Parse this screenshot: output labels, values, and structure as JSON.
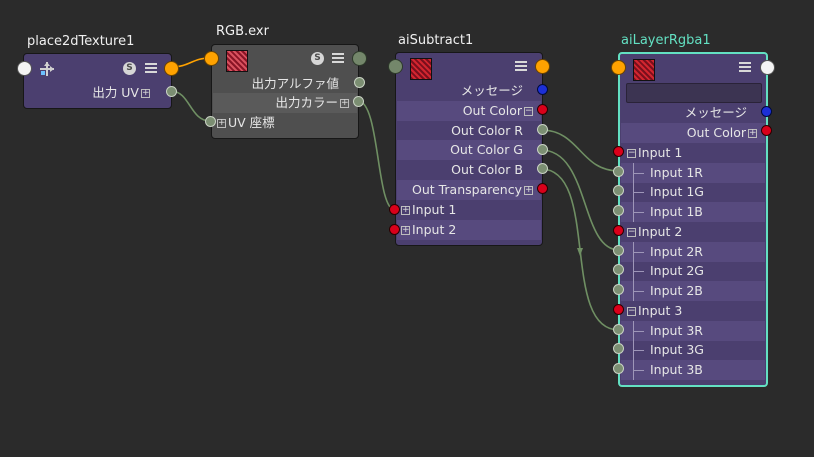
{
  "nodes": {
    "place2d": {
      "title": "place2dTexture1",
      "out_uv": "出力 UV",
      "icon": "transform-icon"
    },
    "rgb": {
      "title": "RGB.exr",
      "out_alpha": "出力アルファ値",
      "out_color": "出力カラー",
      "uv_coord": "UV 座標",
      "icon": "texture-swatch-icon"
    },
    "subtract": {
      "title": "aiSubtract1",
      "message": "メッセージ",
      "out_color": "Out Color",
      "out_r": "Out Color R",
      "out_g": "Out Color G",
      "out_b": "Out Color B",
      "out_transparency": "Out Transparency",
      "input1": "Input 1",
      "input2": "Input 2"
    },
    "layer": {
      "title": "aiLayerRgba1",
      "message": "メッセージ",
      "out_color": "Out Color",
      "input1": "Input 1",
      "input1r": "Input 1R",
      "input1g": "Input 1G",
      "input1b": "Input 1B",
      "input2": "Input 2",
      "input2r": "Input 2R",
      "input2g": "Input 2G",
      "input2b": "Input 2B",
      "input3": "Input 3",
      "input3r": "Input 3R",
      "input3g": "Input 3G",
      "input3b": "Input 3B"
    }
  },
  "icons": {
    "swatch_badge": "S"
  },
  "colors": {
    "background": "#2b2b2b",
    "node_purple": "#4b3f6f",
    "node_gray": "#4f4f4f",
    "selected_border": "#63e0c2",
    "wire_green": "#6f8f63",
    "wire_orange": "#ffa200",
    "port_red": "#d9001a",
    "port_blue": "#1c2fd6"
  }
}
